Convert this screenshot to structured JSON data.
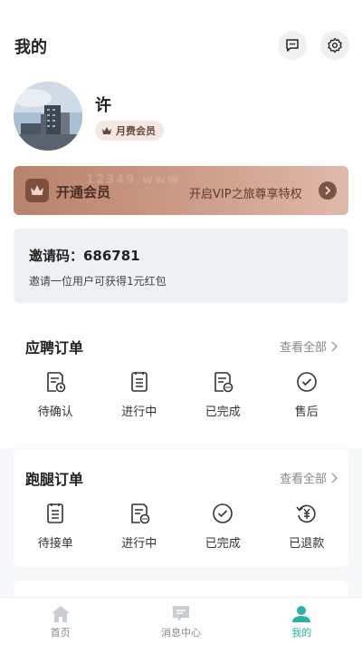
{
  "header": {
    "title": "我的"
  },
  "profile": {
    "name": "许",
    "member_badge": "月费会员"
  },
  "vip": {
    "label": "开通会员",
    "description": "开启VIP之旅尊享特权",
    "watermark": "12349.www"
  },
  "invite": {
    "code_label": "邀请码：686781",
    "description": "邀请一位用户可获得1元红包"
  },
  "orders": [
    {
      "title": "应聘订单",
      "view_all": "查看全部",
      "items": [
        {
          "label": "待确认",
          "icon": "doc-clock-icon"
        },
        {
          "label": "进行中",
          "icon": "doc-list-icon"
        },
        {
          "label": "已完成",
          "icon": "doc-done-icon"
        },
        {
          "label": "售后",
          "icon": "check-circle-icon"
        }
      ]
    },
    {
      "title": "跑腿订单",
      "view_all": "查看全部",
      "items": [
        {
          "label": "待接单",
          "icon": "doc-list-icon"
        },
        {
          "label": "进行中",
          "icon": "doc-more-icon"
        },
        {
          "label": "已完成",
          "icon": "check-circle-icon"
        },
        {
          "label": "已退款",
          "icon": "refund-icon"
        }
      ]
    }
  ],
  "tabbar": {
    "items": [
      {
        "label": "首页",
        "icon": "home-icon"
      },
      {
        "label": "消息中心",
        "icon": "message-icon"
      },
      {
        "label": "我的",
        "icon": "user-icon"
      }
    ],
    "active_index": 2
  },
  "colors": {
    "accent": "#2bb0a6",
    "vip_gradient_start": "#b8826b",
    "vip_gradient_end": "#dfb9a8"
  }
}
